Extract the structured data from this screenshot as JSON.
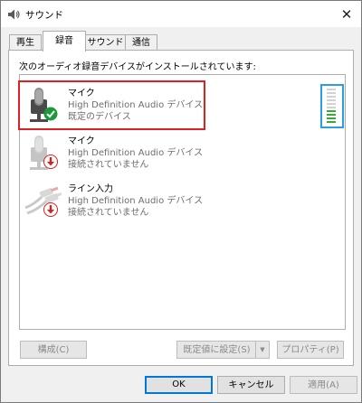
{
  "window": {
    "title": "サウンド"
  },
  "tabs": [
    {
      "label": "再生"
    },
    {
      "label": "録音"
    },
    {
      "label": "サウンド"
    },
    {
      "label": "通信"
    }
  ],
  "instruction": "次のオーディオ録音デバイスがインストールされています:",
  "devices": [
    {
      "name": "マイク",
      "description": "High Definition Audio デバイス",
      "status": "既定のデバイス",
      "icon": "microphone-icon",
      "badge": "default-check-icon",
      "level_percent": 40
    },
    {
      "name": "マイク",
      "description": "High Definition Audio デバイス",
      "status": "接続されていません",
      "icon": "microphone-icon",
      "badge": "disconnected-arrow-icon"
    },
    {
      "name": "ライン入力",
      "description": "High Definition Audio デバイス",
      "status": "接続されていません",
      "icon": "line-in-icon",
      "badge": "disconnected-arrow-icon"
    }
  ],
  "buttons": {
    "configure": "構成(C)",
    "set_default": "既定値に設定(S)",
    "properties": "プロパティ(P)",
    "ok": "OK",
    "cancel": "キャンセル",
    "apply": "適用(A)"
  },
  "colors": {
    "selection_highlight": "#e02020",
    "level_highlight": "#2a9fe0",
    "level_active": "#3aa935",
    "check_badge": "#1a9a3a",
    "disconnected_badge": "#d81e1e"
  }
}
